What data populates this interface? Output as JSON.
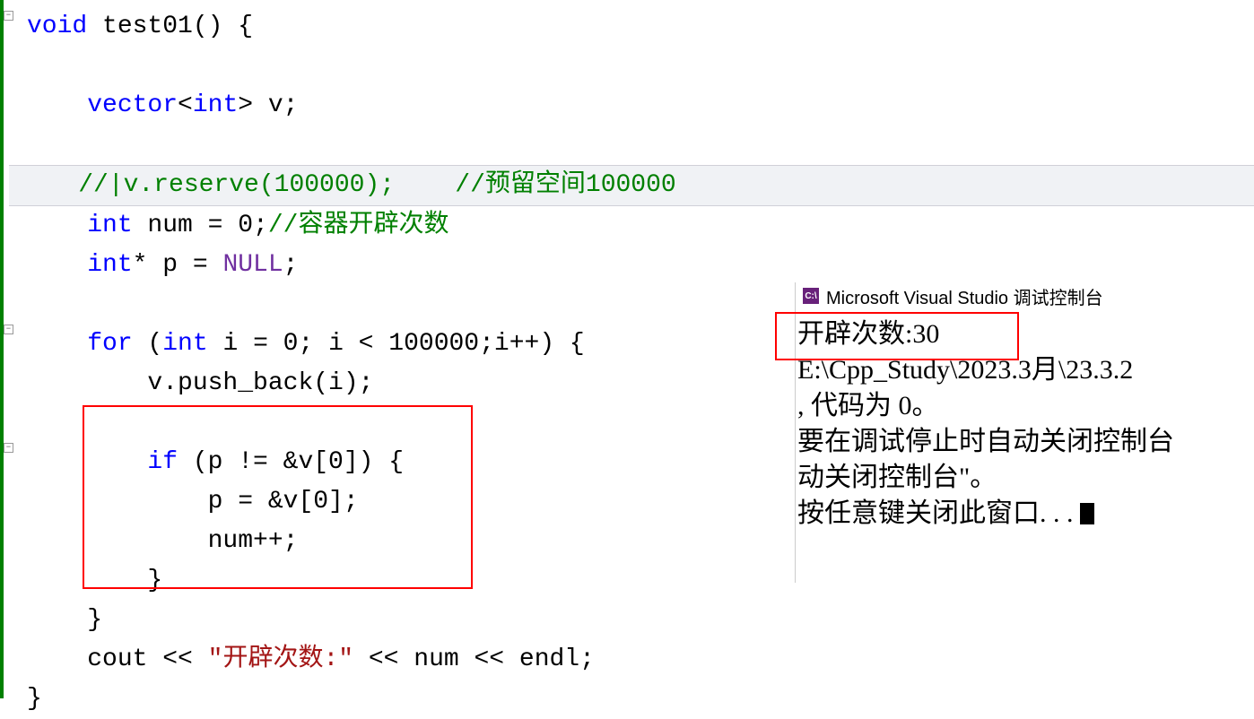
{
  "code": {
    "line1_kw_void": "void",
    "line1_func": " test01() {",
    "line3_type1": "    vector",
    "line3_angle1": "<",
    "line3_type2": "int",
    "line3_angle2": "> v;",
    "line5_comment": "    //|v.reserve(100000);    //预留空间100000",
    "line6_type": "    int",
    "line6_rest": " num = 0;",
    "line6_comment": "//容器开辟次数",
    "line7_type": "    int",
    "line7_rest": "* p = ",
    "line7_null": "NULL",
    "line7_semi": ";",
    "line9_for": "    for",
    "line9_open": " (",
    "line9_int": "int",
    "line9_rest": " i = 0; i < 100000;i++) {",
    "line10": "        v.push_back(i);",
    "line12_if": "        if",
    "line12_rest": " (p != &v[0]) {",
    "line13": "            p = &v[0];",
    "line14": "            num++;",
    "line15": "        }",
    "line16": "    }",
    "line17a": "    cout << ",
    "line17_str": "\"开辟次数:\"",
    "line17b": " << num << endl;",
    "line18": "}"
  },
  "console": {
    "title": "Microsoft Visual Studio 调试控制台",
    "icon_text": "C:\\",
    "line1": "开辟次数:30",
    "line2": "",
    "line3": "E:\\Cpp_Study\\2023.3月\\23.3.2",
    "line4": ", 代码为 0。",
    "line5": "要在调试停止时自动关闭控制台",
    "line6": "动关闭控制台\"。",
    "line7": "按任意键关闭此窗口. . . "
  }
}
